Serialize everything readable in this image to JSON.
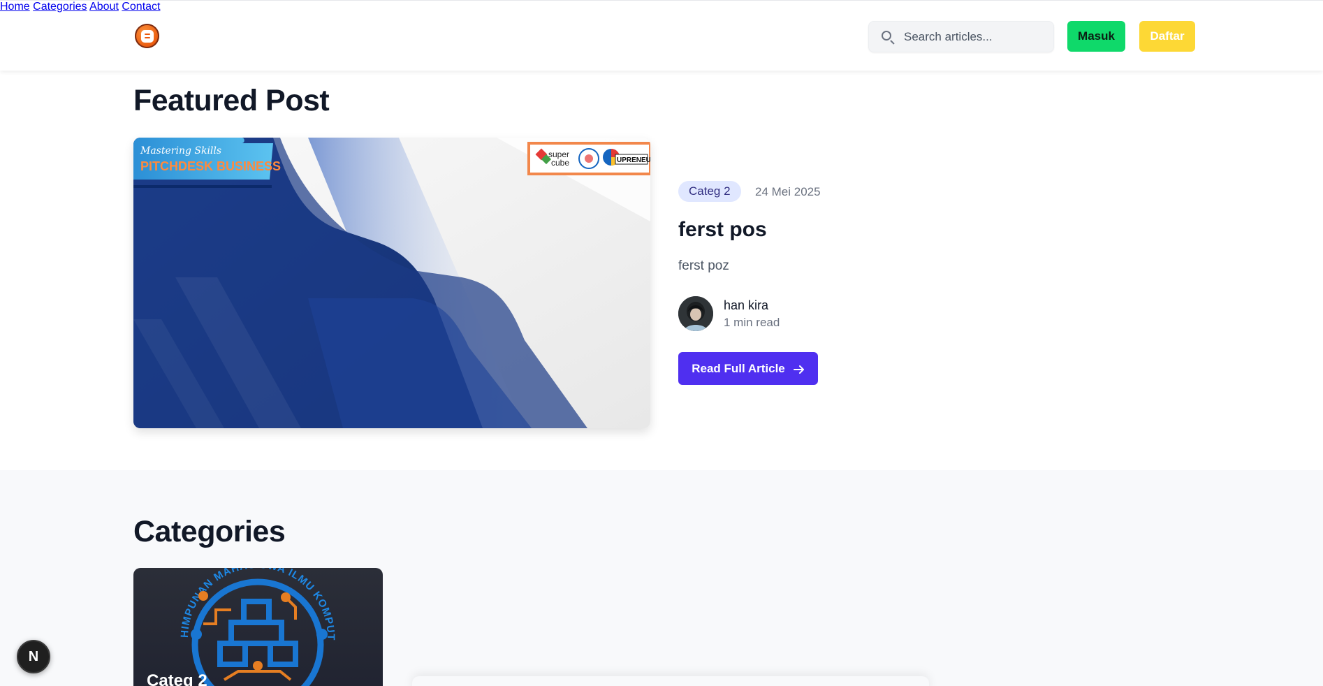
{
  "nav": {
    "items": [
      {
        "label": "Home"
      },
      {
        "label": "Categories"
      },
      {
        "label": "About"
      },
      {
        "label": "Contact"
      }
    ],
    "search_placeholder": "Search articles...",
    "login_label": "Masuk",
    "register_label": "Daftar"
  },
  "featured": {
    "heading": "Featured Post",
    "image_text": {
      "subtitle": "Mastering Skills",
      "title": "PITCHDESK BUSINESS",
      "logo_super": "super",
      "logo_cube": "cube",
      "logo_upreneur": "UPRENEUR"
    },
    "category": "Categ 2",
    "date": "24 Mei 2025",
    "title": "ferst pos",
    "excerpt": "ferst poz",
    "author": "han kira",
    "read_time": "1 min read",
    "cta_label": "Read Full Article"
  },
  "categories": {
    "heading": "Categories",
    "cards": [
      {
        "title": "Categ 2",
        "ring_text": "HIMPUNAN MAHASISWA ILMU KOMPUTER"
      }
    ]
  },
  "dev_badge": "N",
  "colors": {
    "primary": "#4f2ff0",
    "login_green": "#0fd96a",
    "register_yellow": "#fdd835",
    "badge_bg": "#e0e7ff"
  }
}
